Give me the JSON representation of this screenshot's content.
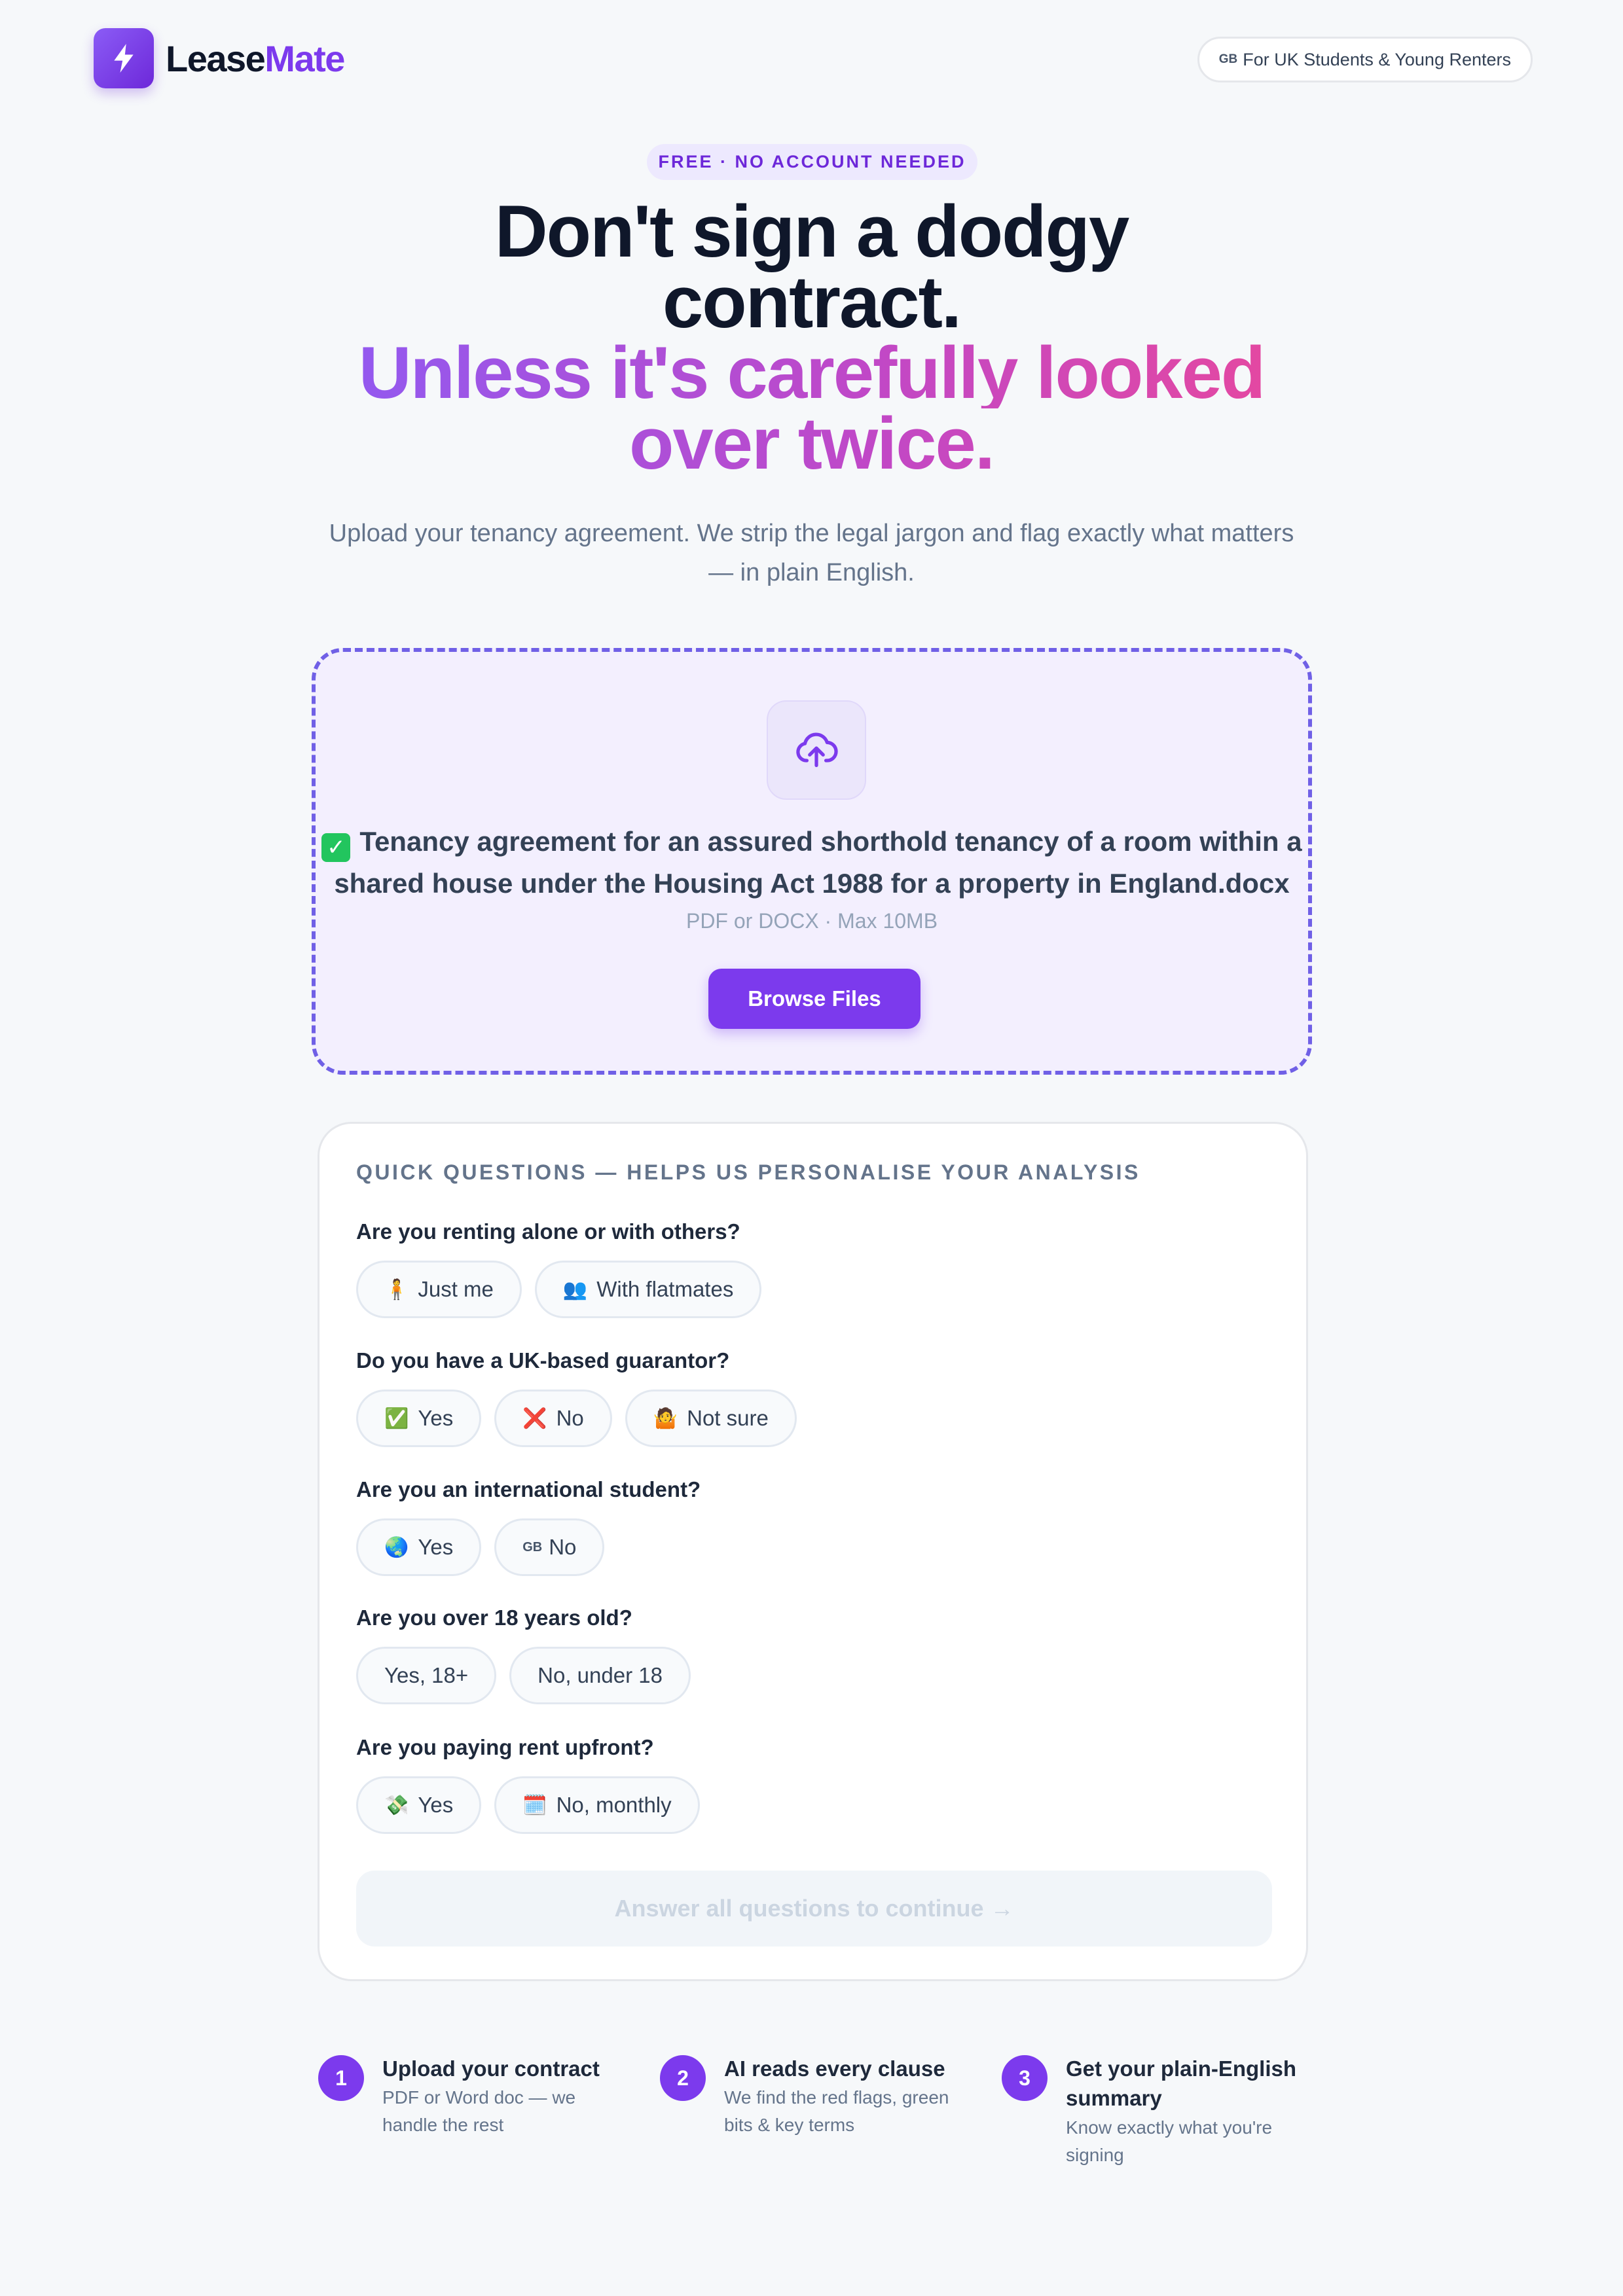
{
  "header": {
    "logo_part1": "Lease",
    "logo_part2": "Mate",
    "region_flag": "GB",
    "region_label": "For UK Students & Young Renters"
  },
  "hero": {
    "badge": "FREE · NO ACCOUNT NEEDED",
    "headline_line1": "Don't sign a dodgy",
    "headline_line2": "contract.",
    "headline_line3": "Unless it's carefully looked",
    "headline_line4": "over twice.",
    "subtitle": "Upload your tenancy agreement. We strip the legal jargon and flag exactly what matters — in plain English."
  },
  "upload": {
    "icon": "cloud-upload-icon",
    "uploaded_file": "Tenancy agreement for an assured shorthold tenancy of a room within a shared house under the Housing Act 1988 for a property in England.docx",
    "hint": "PDF or DOCX · Max 10MB",
    "browse_label": "Browse Files"
  },
  "questions": {
    "title": "QUICK QUESTIONS — HELPS US PERSONALISE YOUR ANALYSIS",
    "items": [
      {
        "label": "Are you renting alone or with others?",
        "options": [
          {
            "emoji": "🧍",
            "text": "Just me"
          },
          {
            "emoji": "👥",
            "text": "With flatmates"
          }
        ]
      },
      {
        "label": "Do you have a UK-based guarantor?",
        "options": [
          {
            "emoji": "✅",
            "text": "Yes"
          },
          {
            "emoji": "❌",
            "text": "No"
          },
          {
            "emoji": "🤷",
            "text": "Not sure"
          }
        ]
      },
      {
        "label": "Are you an international student?",
        "options": [
          {
            "emoji": "🌏",
            "text": "Yes"
          },
          {
            "emoji": "GB",
            "text": "No"
          }
        ]
      },
      {
        "label": "Are you over 18 years old?",
        "options": [
          {
            "emoji": "",
            "text": "Yes, 18+"
          },
          {
            "emoji": "",
            "text": "No, under 18"
          }
        ]
      },
      {
        "label": "Are you paying rent upfront?",
        "options": [
          {
            "emoji": "💸",
            "text": "Yes"
          },
          {
            "emoji": "🗓️",
            "text": "No, monthly"
          }
        ]
      }
    ],
    "continue_label": "Answer all questions to continue →"
  },
  "steps": [
    {
      "num": "1",
      "title": "Upload your contract",
      "desc": "PDF or Word doc — we handle the rest"
    },
    {
      "num": "2",
      "title": "AI reads every clause",
      "desc": "We find the red flags, green bits & key terms"
    },
    {
      "num": "3",
      "title": "Get your plain-English summary",
      "desc": "Know exactly what you're signing"
    }
  ],
  "colors": {
    "brand": "#7c3aed",
    "gradient_start": "#8b5cf6",
    "gradient_end": "#ec4899",
    "dropzone_border": "#7060e6"
  }
}
